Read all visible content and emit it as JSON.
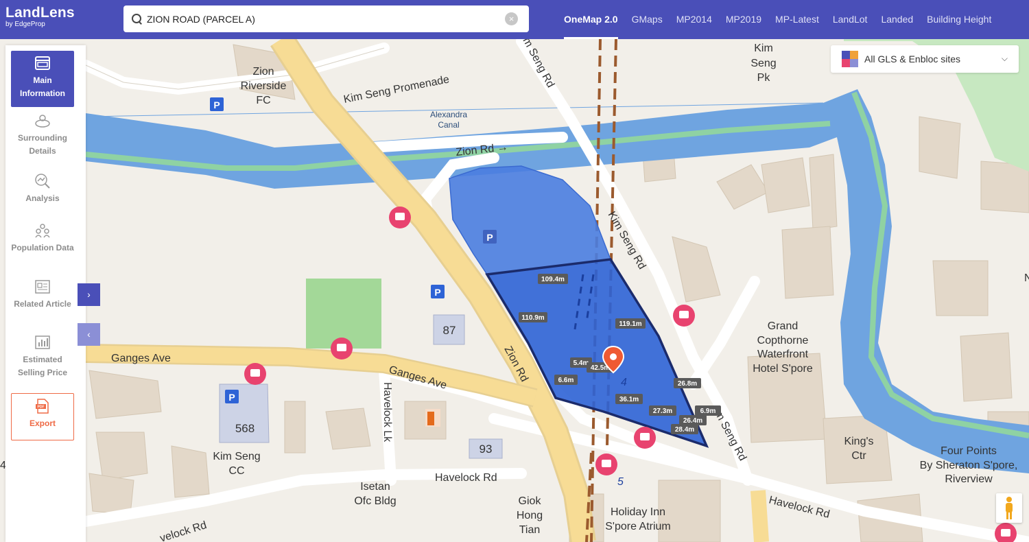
{
  "brand": {
    "name": "LandLens",
    "by": "by EdgeProp"
  },
  "search": {
    "value": "ZION ROAD (PARCEL A)",
    "clear_icon": "×"
  },
  "nav_tabs": [
    {
      "label": "OneMap 2.0",
      "active": true
    },
    {
      "label": "GMaps"
    },
    {
      "label": "MP2014"
    },
    {
      "label": "MP2019"
    },
    {
      "label": "MP-Latest"
    },
    {
      "label": "LandLot"
    },
    {
      "label": "Landed"
    },
    {
      "label": "Building Height"
    }
  ],
  "sidebar": {
    "items": [
      {
        "label": "Main Information",
        "icon": "browser-window-icon",
        "active": true
      },
      {
        "label": "Surrounding Details",
        "icon": "location-layers-icon"
      },
      {
        "label": "Analysis",
        "icon": "magnify-chart-icon"
      },
      {
        "label": "Population Data",
        "icon": "people-group-icon"
      },
      {
        "label": "Related Article",
        "icon": "article-icon"
      },
      {
        "label": "Estimated Selling Price",
        "icon": "bar-chart-icon"
      },
      {
        "label": "Export",
        "icon": "pdf-icon",
        "icon_text": "PDF"
      }
    ],
    "expand_arrow": "›",
    "collapse_arrow": "‹"
  },
  "layer_dropdown": {
    "selected": "All GLS & Enbloc sites",
    "chevron": "⌵"
  },
  "map": {
    "place_labels": {
      "zion_riverside_fc": [
        "Zion",
        "Riverside",
        "FC"
      ],
      "kim_seng_pk": [
        "Kim",
        "Seng",
        "Pk"
      ],
      "alexandra_canal": [
        "Alexandra",
        "Canal"
      ],
      "grand_copthorne": [
        "Grand",
        "Copthorne",
        "Waterfront",
        "Hotel S'pore"
      ],
      "kings_ctr": [
        "King's",
        "Ctr"
      ],
      "four_points": [
        "Four Points",
        "By Sheraton S'pore,",
        "Riverview"
      ],
      "kim_seng_cc": [
        "Kim Seng",
        "CC"
      ],
      "isetan": [
        "Isetan",
        "Ofc Bldg"
      ],
      "giok_hong": [
        "Giok",
        "Hong",
        "Tian"
      ],
      "holiday_inn": [
        "Holiday Inn",
        "S'pore Atrium"
      ]
    },
    "road_labels": {
      "kim_seng_promenade": "Kim Seng Promenade",
      "zion_rd_top": "Zion Rd →",
      "kim_seng_rd_top": "m Seng Rd",
      "kim_seng_rd_mid": "Kim Seng Rd",
      "kim_seng_rd_bottom": "m Seng Rd",
      "zion_rd_mid": "Zion Rd",
      "ganges_ave_left": "Ganges Ave",
      "ganges_ave_right": "Ganges Ave",
      "havelock_lk": "Havelock Lk",
      "havelock_rd_mid": "Havelock Rd",
      "havelock_rd_right": "Havelock Rd",
      "havelock_rd_left": "velock Rd"
    },
    "block_numbers": {
      "b87": "87",
      "b568": "568",
      "b93": "93"
    },
    "edge_labels": {
      "right_n": "N",
      "left_4": "4",
      "lot_4": "4",
      "lot_5": "5"
    },
    "parking_label": "P",
    "dimensions": [
      "109.4m",
      "110.9m",
      "119.1m",
      "5.4m",
      "42.5m",
      "6.6m",
      "36.1m",
      "26.8m",
      "27.3m",
      "6.9m",
      "26.4m",
      "28.4m"
    ]
  },
  "colors": {
    "topbar": "#4a4fb8",
    "parcel_b": "#4a7de0",
    "parcel_a": "#2e63d6",
    "water": "#6fa4e0",
    "park": "#a3d898",
    "road_major": "#f7dc95",
    "export": "#ef6a45",
    "bus_stop": "#e8436f"
  }
}
